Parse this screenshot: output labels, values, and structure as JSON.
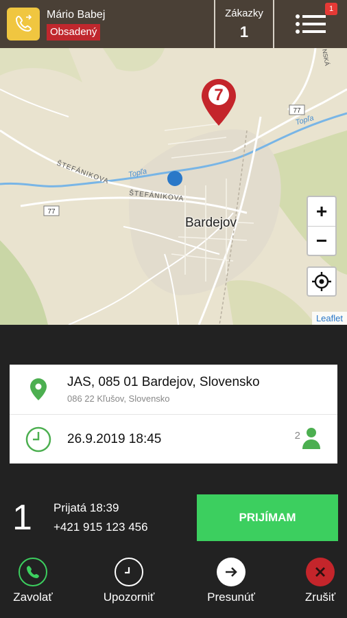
{
  "header": {
    "driver_name": "Mário Babej",
    "status": "Obsadený",
    "orders_label": "Zákazky",
    "orders_count": "1",
    "menu_badge": "1"
  },
  "map": {
    "city_label": "Bardejov",
    "street_label_1": "ŠTEFÁNIKOVA",
    "street_label_2": "ŠTEFÁNIKOVA",
    "river_label_1": "Topľa",
    "river_label_2": "Topľa",
    "road_77_a": "77",
    "road_77_b": "77",
    "road_nska": "NSKÁ",
    "marker_number": "7",
    "zoom_in": "+",
    "zoom_out": "−",
    "attribution": "Leaflet"
  },
  "order": {
    "address_main": "JAS, 085 01 Bardejov, Slovensko",
    "address_sub": "086 22 Kľušov, Slovensko",
    "datetime": "26.9.2019 18:45",
    "passengers": "2",
    "number": "1",
    "accepted": "Prijatá 18:39",
    "phone": "+421 915 123 456",
    "accept_button": "PRIJÍMAM"
  },
  "actions": {
    "call": "Zavolať",
    "notify": "Upozorniť",
    "move": "Presunúť",
    "cancel": "Zrušiť"
  },
  "colors": {
    "header_bg": "#4a4036",
    "status_red": "#c0272d",
    "accept_green": "#3ccf5f",
    "marker_red": "#c4252b",
    "location_blue": "#2a78c8",
    "icon_green": "#4caf50"
  }
}
